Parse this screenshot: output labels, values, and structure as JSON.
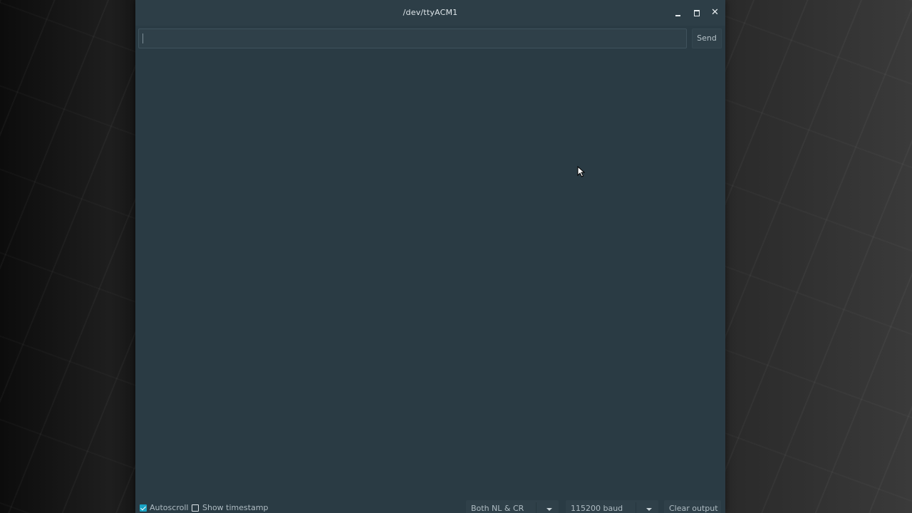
{
  "window": {
    "title": "/dev/ttyACM1",
    "controls": {
      "minimize": "minimize",
      "maximize": "maximize",
      "close": "close"
    }
  },
  "send_row": {
    "input_value": "",
    "input_placeholder": "",
    "send_label": "Send"
  },
  "output": {
    "text": ""
  },
  "status_bar": {
    "autoscroll": {
      "label": "Autoscroll",
      "checked": true
    },
    "show_timestamp": {
      "label": "Show timestamp",
      "checked": false
    },
    "line_ending": {
      "selected": "Both NL & CR"
    },
    "baud_rate": {
      "selected": "115200 baud"
    },
    "clear_label": "Clear output"
  },
  "icons": {
    "minimize": "minimize-icon",
    "maximize": "maximize-icon",
    "close": "close-icon",
    "dropdown": "chevron-down-icon",
    "pointer": "mouse-pointer-icon"
  },
  "colors": {
    "window_bg": "#2a3b44",
    "accent": "#1aa3c4",
    "text": "#dfe6ea"
  }
}
